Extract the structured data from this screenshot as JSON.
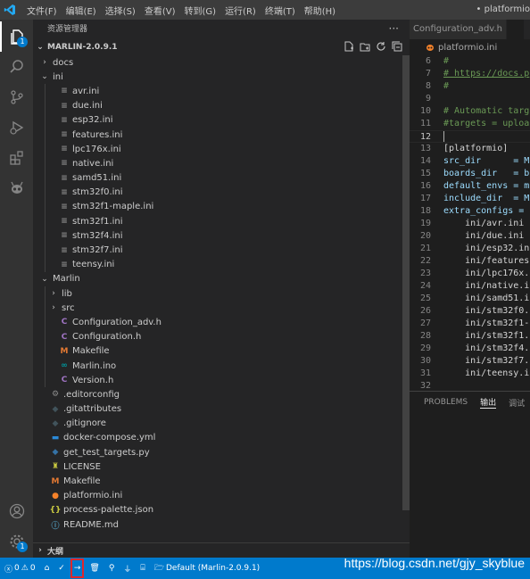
{
  "menu": [
    "文件(F)",
    "编辑(E)",
    "选择(S)",
    "查看(V)",
    "转到(G)",
    "运行(R)",
    "终端(T)",
    "帮助(H)"
  ],
  "window_title": "• platformio",
  "activity": {
    "explorer_badge": "1",
    "manage_badge": "1"
  },
  "sidebar": {
    "title": "资源管理器",
    "more": "···",
    "section": "MARLIN-2.0.9.1",
    "tree": [
      {
        "depth": 1,
        "type": "folder",
        "open": false,
        "label": "docs"
      },
      {
        "depth": 1,
        "type": "folder",
        "open": true,
        "label": "ini"
      },
      {
        "depth": 2,
        "type": "ini",
        "label": "avr.ini"
      },
      {
        "depth": 2,
        "type": "ini",
        "label": "due.ini"
      },
      {
        "depth": 2,
        "type": "ini",
        "label": "esp32.ini"
      },
      {
        "depth": 2,
        "type": "ini",
        "label": "features.ini"
      },
      {
        "depth": 2,
        "type": "ini",
        "label": "lpc176x.ini"
      },
      {
        "depth": 2,
        "type": "ini",
        "label": "native.ini"
      },
      {
        "depth": 2,
        "type": "ini",
        "label": "samd51.ini"
      },
      {
        "depth": 2,
        "type": "ini",
        "label": "stm32f0.ini"
      },
      {
        "depth": 2,
        "type": "ini",
        "label": "stm32f1-maple.ini"
      },
      {
        "depth": 2,
        "type": "ini",
        "label": "stm32f1.ini"
      },
      {
        "depth": 2,
        "type": "ini",
        "label": "stm32f4.ini"
      },
      {
        "depth": 2,
        "type": "ini",
        "label": "stm32f7.ini"
      },
      {
        "depth": 2,
        "type": "ini",
        "label": "teensy.ini"
      },
      {
        "depth": 1,
        "type": "folder",
        "open": true,
        "label": "Marlin"
      },
      {
        "depth": 2,
        "type": "folder",
        "open": false,
        "label": "lib"
      },
      {
        "depth": 2,
        "type": "folder",
        "open": false,
        "label": "src"
      },
      {
        "depth": 2,
        "type": "h",
        "label": "Configuration_adv.h"
      },
      {
        "depth": 2,
        "type": "h",
        "label": "Configuration.h"
      },
      {
        "depth": 2,
        "type": "make",
        "label": "Makefile"
      },
      {
        "depth": 2,
        "type": "ino",
        "label": "Marlin.ino"
      },
      {
        "depth": 2,
        "type": "h",
        "label": "Version.h"
      },
      {
        "depth": 1,
        "type": "gear",
        "label": ".editorconfig"
      },
      {
        "depth": 1,
        "type": "git",
        "label": ".gitattributes"
      },
      {
        "depth": 1,
        "type": "git",
        "label": ".gitignore"
      },
      {
        "depth": 1,
        "type": "docker",
        "label": "docker-compose.yml"
      },
      {
        "depth": 1,
        "type": "py",
        "label": "get_test_targets.py"
      },
      {
        "depth": 1,
        "type": "license",
        "label": "LICENSE"
      },
      {
        "depth": 1,
        "type": "make",
        "label": "Makefile"
      },
      {
        "depth": 1,
        "type": "pio",
        "label": "platformio.ini"
      },
      {
        "depth": 1,
        "type": "json",
        "label": "process-palette.json"
      },
      {
        "depth": 1,
        "type": "md",
        "label": "README.md"
      }
    ],
    "outline": "大纲"
  },
  "editor": {
    "tabs": [
      {
        "label": "Configuration_adv.h",
        "active": false
      },
      {
        "label": "",
        "active": true
      }
    ],
    "breadcrumb": "platformio.ini",
    "lines": [
      {
        "n": "6",
        "text": "#",
        "kind": "cmt"
      },
      {
        "n": "7",
        "text": "# https://docs.p",
        "kind": "link"
      },
      {
        "n": "8",
        "text": "#",
        "kind": "cmt"
      },
      {
        "n": "9",
        "text": "",
        "kind": "plain"
      },
      {
        "n": "10",
        "text": "# Automatic targ",
        "kind": "cmt"
      },
      {
        "n": "11",
        "text": "#targets = uploa",
        "kind": "cmt"
      },
      {
        "n": "12",
        "text": "",
        "kind": "caret"
      },
      {
        "n": "13",
        "text": "[platformio]",
        "kind": "sect"
      },
      {
        "n": "14",
        "text": "src_dir      = M",
        "kind": "key"
      },
      {
        "n": "15",
        "text": "boards_dir   = b",
        "kind": "key"
      },
      {
        "n": "16",
        "text": "default_envs = m",
        "kind": "key"
      },
      {
        "n": "17",
        "text": "include_dir  = M",
        "kind": "key"
      },
      {
        "n": "18",
        "text": "extra_configs =",
        "kind": "key"
      },
      {
        "n": "19",
        "text": "    ini/avr.ini",
        "kind": "plain"
      },
      {
        "n": "20",
        "text": "    ini/due.ini",
        "kind": "plain"
      },
      {
        "n": "21",
        "text": "    ini/esp32.in",
        "kind": "plain"
      },
      {
        "n": "22",
        "text": "    ini/features",
        "kind": "plain"
      },
      {
        "n": "23",
        "text": "    ini/lpc176x.",
        "kind": "plain"
      },
      {
        "n": "24",
        "text": "    ini/native.i",
        "kind": "plain"
      },
      {
        "n": "25",
        "text": "    ini/samd51.i",
        "kind": "plain"
      },
      {
        "n": "26",
        "text": "    ini/stm32f0.",
        "kind": "plain"
      },
      {
        "n": "27",
        "text": "    ini/stm32f1-",
        "kind": "plain"
      },
      {
        "n": "28",
        "text": "    ini/stm32f1.",
        "kind": "plain"
      },
      {
        "n": "29",
        "text": "    ini/stm32f4.",
        "kind": "plain"
      },
      {
        "n": "30",
        "text": "    ini/stm32f7.",
        "kind": "plain"
      },
      {
        "n": "31",
        "text": "    ini/teensy.i",
        "kind": "plain"
      },
      {
        "n": "32",
        "text": "",
        "kind": "plain"
      }
    ],
    "current_line": "12"
  },
  "panel": {
    "tabs": [
      "PROBLEMS",
      "输出",
      "调试"
    ],
    "active": "输出"
  },
  "status": {
    "errors": "0",
    "warnings": "0",
    "env": "Default (Marlin-2.0.9.1)"
  },
  "watermark": "https://blog.csdn.net/gjy_skyblue",
  "colors": {
    "statusbar": "#007acc",
    "activitybar": "#333333",
    "sidebar": "#252526",
    "editor": "#1e1e1e",
    "highlight": "#e0262b"
  }
}
